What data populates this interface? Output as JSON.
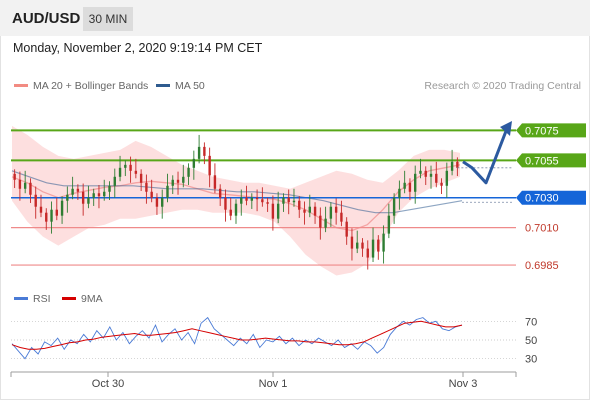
{
  "header": {
    "symbol": "AUD/USD",
    "timeframe": "30 MIN",
    "datetime": "Monday, November 2, 2020 9:19:14 PM CET"
  },
  "legend": {
    "bollinger_label": "MA 20 + Bollinger Bands",
    "bollinger_color": "#f28b82",
    "ma50_label": "MA 50",
    "ma50_color": "#2f5b8f",
    "copyright": "Research © 2020 Trading Central"
  },
  "rsi_legend": {
    "rsi_label": "RSI",
    "rsi_color": "#4a7bd6",
    "ma9_label": "9MA",
    "ma9_color": "#d50000"
  },
  "colors": {
    "resistance": "#58a618",
    "pivot": "#1565d8",
    "support": "#ef8a8a",
    "support_text": "#c0392b",
    "forecast": "#2c5aa0",
    "band_fill": "#fdd9d9",
    "candle_up": "#2e7d32",
    "candle_down": "#c62828"
  },
  "chart_data": [
    {
      "type": "line",
      "title": "AUD/USD 30 MIN",
      "x_ticks": [
        "Oct 30",
        "Nov 1",
        "Nov 3"
      ],
      "ylim": [
        0.6975,
        0.709
      ],
      "levels": [
        {
          "value": 0.7075,
          "label": "0.7075",
          "role": "resistance"
        },
        {
          "value": 0.7055,
          "label": "0.7055",
          "role": "resistance"
        },
        {
          "value": 0.703,
          "label": "0.7030",
          "role": "pivot"
        },
        {
          "value": 0.701,
          "label": "0.7010",
          "role": "support"
        },
        {
          "value": 0.6985,
          "label": "0.6985",
          "role": "support"
        }
      ],
      "series": [
        {
          "values": [
            0.7042,
            0.7036,
            0.704,
            0.7032,
            0.7024,
            0.702,
            0.7014,
            0.7022,
            0.7018,
            0.7028,
            0.7032,
            0.7036,
            0.7034,
            0.7026,
            0.703,
            0.7033,
            0.7031,
            0.7034,
            0.7038,
            0.7044,
            0.705,
            0.7052,
            0.7048,
            0.7046,
            0.704,
            0.7034,
            0.703,
            0.7024,
            0.703,
            0.7038,
            0.7042,
            0.704,
            0.7044,
            0.705,
            0.7056,
            0.7064,
            0.7058,
            0.7045,
            0.7036,
            0.703,
            0.7022,
            0.7018,
            0.7026,
            0.703,
            0.7028,
            0.703,
            0.7029,
            0.7027,
            0.7026,
            0.7016,
            0.7026,
            0.703,
            0.7027,
            0.7028,
            0.7022,
            0.702,
            0.7024,
            0.7018,
            0.701,
            0.7016,
            0.7024,
            0.702,
            0.7014,
            0.7004,
            0.6996,
            0.7,
            0.6996,
            0.699,
            0.7002,
            0.6994,
            0.7006,
            0.7018,
            0.703,
            0.7036,
            0.704,
            0.7034,
            0.7046,
            0.7048,
            0.7044,
            0.7046,
            0.704,
            0.7038,
            0.7048,
            0.7054,
            0.705
          ]
        },
        {
          "name": "MA 20 + Bollinger Bands",
          "values": [
            0.7044,
            0.704,
            0.7034,
            0.703,
            0.7033,
            0.7035,
            0.7037,
            0.7038,
            0.704,
            0.7041,
            0.704,
            0.7039,
            0.7036,
            0.7033,
            0.7032,
            0.7031,
            0.703,
            0.7029,
            0.7026,
            0.7022,
            0.7016,
            0.701,
            0.7008,
            0.7012,
            0.7022,
            0.7034,
            0.7042,
            0.7048,
            0.705,
            0.7052
          ],
          "upper": [
            0.7078,
            0.7072,
            0.7064,
            0.7058,
            0.7056,
            0.7058,
            0.706,
            0.7062,
            0.7068,
            0.7064,
            0.7058,
            0.7052,
            0.7048,
            0.7044,
            0.7042,
            0.704,
            0.704,
            0.7038,
            0.7036,
            0.704,
            0.7044,
            0.7048,
            0.7046,
            0.7042,
            0.704,
            0.7048,
            0.7058,
            0.7062,
            0.7062,
            0.706
          ],
          "lower": [
            0.7028,
            0.7014,
            0.7004,
            0.6998,
            0.7004,
            0.701,
            0.7012,
            0.7016,
            0.7016,
            0.7018,
            0.702,
            0.7022,
            0.7022,
            0.702,
            0.702,
            0.702,
            0.7018,
            0.7014,
            0.7004,
            0.6992,
            0.6984,
            0.6978,
            0.698,
            0.6986,
            0.7002,
            0.702,
            0.703,
            0.7036,
            0.704,
            0.7044
          ]
        },
        {
          "name": "MA 50",
          "values": [
            0.7048,
            0.7044,
            0.704,
            0.7038,
            0.7038,
            0.7038,
            0.7038,
            0.7038,
            0.7037,
            0.7036,
            0.7036,
            0.7036,
            0.7035,
            0.7034,
            0.7034,
            0.7033,
            0.7032,
            0.703,
            0.7028,
            0.7025,
            0.7022,
            0.702,
            0.702,
            0.7022,
            0.7024,
            0.7026,
            0.7028
          ]
        }
      ],
      "forecast": {
        "values": [
          0.7054,
          0.705,
          0.704,
          0.7078
        ]
      }
    },
    {
      "type": "line",
      "ylim": [
        20,
        80
      ],
      "y_ticks": [
        "70",
        "50",
        "30"
      ],
      "series": [
        {
          "name": "RSI",
          "values": [
            46,
            38,
            30,
            42,
            35,
            48,
            44,
            52,
            40,
            50,
            46,
            56,
            48,
            60,
            52,
            64,
            50,
            58,
            46,
            54,
            60,
            52,
            66,
            48,
            56,
            62,
            50,
            58,
            46,
            68,
            74,
            62,
            56,
            50,
            44,
            52,
            46,
            56,
            42,
            50,
            48,
            54,
            46,
            52,
            44,
            50,
            46,
            52,
            48,
            44,
            50,
            42,
            46,
            40,
            48,
            44,
            36,
            42,
            56,
            64,
            70,
            66,
            72,
            74,
            68,
            70,
            62,
            60,
            64,
            66
          ]
        },
        {
          "name": "9MA",
          "values": [
            45,
            42,
            40,
            40,
            41,
            43,
            45,
            47,
            48,
            50,
            51,
            53,
            54,
            55,
            56,
            57,
            55,
            55,
            56,
            57,
            58,
            60,
            62,
            60,
            58,
            56,
            54,
            52,
            50,
            50,
            51,
            52,
            51,
            50,
            49,
            49,
            48,
            48,
            47,
            46,
            45,
            45,
            46,
            48,
            52,
            56,
            60,
            64,
            68,
            69,
            70,
            68,
            66,
            64,
            64,
            66
          ]
        }
      ]
    }
  ]
}
